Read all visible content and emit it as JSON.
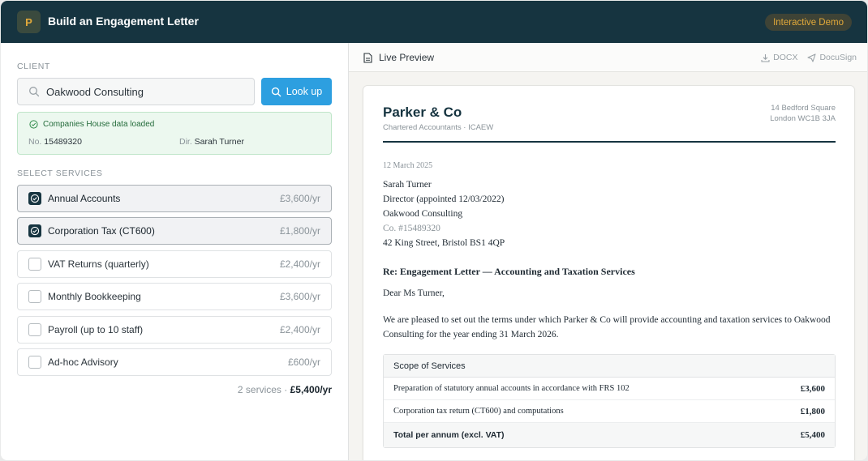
{
  "header": {
    "logo": "P",
    "title": "Build an Engagement Letter",
    "badge": "Interactive Demo"
  },
  "client": {
    "label": "CLIENT",
    "search_value": "Oakwood Consulting",
    "lookup_label": "Look up",
    "status": "Companies House data loaded",
    "no_label": "No.",
    "no_value": "15489320",
    "dir_label": "Dir.",
    "dir_value": "Sarah Turner"
  },
  "services": {
    "label": "SELECT SERVICES",
    "items": [
      {
        "name": "Annual Accounts",
        "price": "£3,600/yr",
        "selected": true
      },
      {
        "name": "Corporation Tax (CT600)",
        "price": "£1,800/yr",
        "selected": true
      },
      {
        "name": "VAT Returns (quarterly)",
        "price": "£2,400/yr",
        "selected": false
      },
      {
        "name": "Monthly Bookkeeping",
        "price": "£3,600/yr",
        "selected": false
      },
      {
        "name": "Payroll (up to 10 staff)",
        "price": "£2,400/yr",
        "selected": false
      },
      {
        "name": "Ad-hoc Advisory",
        "price": "£600/yr",
        "selected": false
      }
    ],
    "summary_count": "2 services ·",
    "summary_total": "£5,400/yr"
  },
  "preview": {
    "title": "Live Preview",
    "docx": "DOCX",
    "docusign": "DocuSign",
    "firm": "Parker & Co",
    "firm_sub": "Chartered Accountants · ICAEW",
    "addr1": "14 Bedford Square",
    "addr2": "London WC1B 3JA",
    "date": "12 March 2025",
    "recipient": {
      "name": "Sarah Turner",
      "role": "Director (appointed 12/03/2022)",
      "company": "Oakwood Consulting",
      "co_no": "Co. #15489320",
      "address": "42 King Street, Bristol BS1 4QP"
    },
    "re": "Re: Engagement Letter — Accounting and Taxation Services",
    "salutation": "Dear Ms Turner,",
    "body": "We are pleased to set out the terms under which Parker & Co will provide accounting and taxation services to Oakwood Consulting for the year ending 31 March 2026.",
    "scope": {
      "heading": "Scope of Services",
      "rows": [
        {
          "desc": "Preparation of statutory annual accounts in accordance with FRS 102",
          "amount": "£3,600"
        },
        {
          "desc": "Corporation tax return (CT600) and computations",
          "amount": "£1,800"
        }
      ],
      "total_label": "Total per annum (excl. VAT)",
      "total_amount": "£5,400"
    }
  },
  "colors": {
    "brand": "#163440",
    "accent": "#2d9fe0",
    "badge": "#e2a93a",
    "success": "#236b3a"
  }
}
